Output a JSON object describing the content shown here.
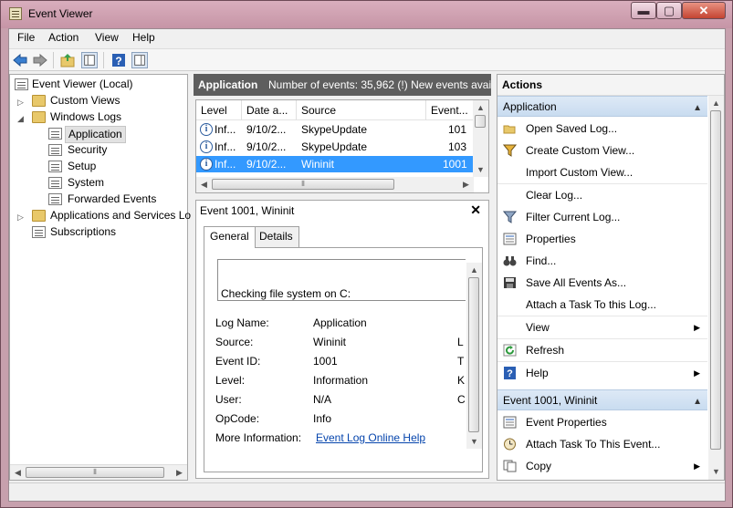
{
  "window": {
    "title": "Event Viewer",
    "controls": {
      "minimize": "▬",
      "maximize": "▢",
      "close": "✕"
    }
  },
  "menu": [
    "File",
    "Action",
    "View",
    "Help"
  ],
  "toolbar": {
    "icons": [
      "back-icon",
      "forward-icon",
      "up-folder-icon",
      "show-hide-tree-icon",
      "help-icon",
      "show-hide-action-pane-icon"
    ]
  },
  "tree": {
    "root": "Event Viewer (Local)",
    "custom_views": "Custom Views",
    "windows_logs": "Windows Logs",
    "logs": [
      "Application",
      "Security",
      "Setup",
      "System",
      "Forwarded Events"
    ],
    "apps_services": "Applications and Services Lo",
    "subscriptions": "Subscriptions"
  },
  "log_header": {
    "name": "Application",
    "info": "Number of events: 35,962 (!) New events avai..."
  },
  "event_table": {
    "columns": [
      "Level",
      "Date a...",
      "Source",
      "Event..."
    ],
    "rows": [
      {
        "level": "Inf...",
        "date": "9/10/2...",
        "source": "SkypeUpdate",
        "id": "101",
        "selected": false
      },
      {
        "level": "Inf...",
        "date": "9/10/2...",
        "source": "SkypeUpdate",
        "id": "103",
        "selected": false
      },
      {
        "level": "Inf...",
        "date": "9/10/2...",
        "source": "Wininit",
        "id": "1001",
        "selected": true
      }
    ]
  },
  "detail": {
    "title": "Event 1001, Wininit",
    "close": "✕",
    "tabs": [
      "General",
      "Details"
    ],
    "description": "Checking file system on C:",
    "fields": [
      {
        "label": "Log Name:",
        "value": "Application",
        "extra": ""
      },
      {
        "label": "Source:",
        "value": "Wininit",
        "extra": "L"
      },
      {
        "label": "Event ID:",
        "value": "1001",
        "extra": "T"
      },
      {
        "label": "Level:",
        "value": "Information",
        "extra": "K"
      },
      {
        "label": "User:",
        "value": "N/A",
        "extra": "C"
      },
      {
        "label": "OpCode:",
        "value": "Info",
        "extra": ""
      }
    ],
    "more_info_label": "More Information:",
    "more_info_link": "Event Log Online Help"
  },
  "actions": {
    "header": "Actions",
    "section1": "Application",
    "section1_items": [
      {
        "label": "Open Saved Log...",
        "icon": "open-folder-icon"
      },
      {
        "label": "Create Custom View...",
        "icon": "filter-icon"
      },
      {
        "label": "Import Custom View...",
        "icon": ""
      },
      {
        "label": "Clear Log...",
        "icon": ""
      },
      {
        "label": "Filter Current Log...",
        "icon": "filter-icon"
      },
      {
        "label": "Properties",
        "icon": "properties-icon"
      },
      {
        "label": "Find...",
        "icon": "binoculars-icon"
      },
      {
        "label": "Save All Events As...",
        "icon": "save-icon"
      },
      {
        "label": "Attach a Task To this Log...",
        "icon": ""
      },
      {
        "label": "View",
        "icon": ""
      },
      {
        "label": "Refresh",
        "icon": "refresh-icon"
      },
      {
        "label": "Help",
        "icon": "help-icon"
      }
    ],
    "section2": "Event 1001, Wininit",
    "section2_items": [
      {
        "label": "Event Properties",
        "icon": "properties-icon"
      },
      {
        "label": "Attach Task To This Event...",
        "icon": "task-icon"
      },
      {
        "label": "Copy",
        "icon": "copy-icon"
      }
    ]
  },
  "colors": {
    "selection": "#3399ff",
    "header_bar": "#5e5e5e",
    "section_header": "#c9dcf0",
    "link": "#0645ad"
  }
}
